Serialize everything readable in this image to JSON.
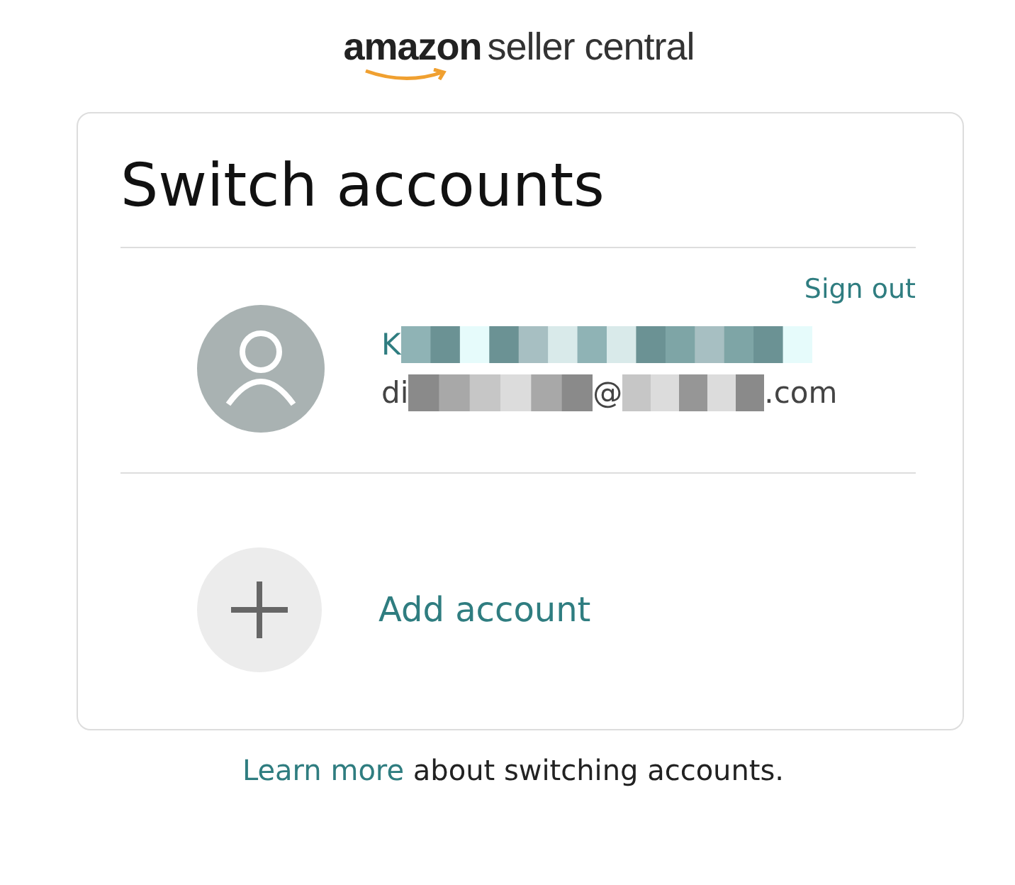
{
  "logo": {
    "brand": "amazon",
    "product": "seller central"
  },
  "card": {
    "title": "Switch accounts",
    "sign_out": "Sign out",
    "accounts": [
      {
        "name": "K",
        "email_start": "di",
        "email_at": "@",
        "email_end": ".com",
        "redacted": true
      }
    ],
    "add_account": "Add account"
  },
  "footer": {
    "link": "Learn more",
    "text": "about switching accounts."
  }
}
